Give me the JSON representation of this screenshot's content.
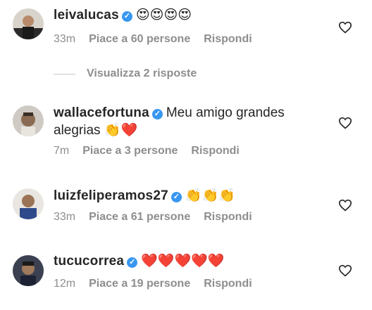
{
  "comments": [
    {
      "username": "leivalucas",
      "text": "",
      "emojis": "😍😍😍😍",
      "time": "33m",
      "likes": "Piace a 60 persone",
      "reply": "Rispondi"
    },
    {
      "username": "wallacefortuna",
      "text": "Meu amigo grandes",
      "text2": "alegrias",
      "emojis": "👏❤️",
      "time": "7m",
      "likes": "Piace a 3 persone",
      "reply": "Rispondi"
    },
    {
      "username": "luizfeliperamos27",
      "text": "",
      "emojis": "👏👏👏",
      "time": "33m",
      "likes": "Piace a 61 persone",
      "reply": "Rispondi"
    },
    {
      "username": "tucucorrea",
      "text": "",
      "emojis": "❤️❤️❤️❤️❤️",
      "time": "12m",
      "likes": "Piace a 19 persone",
      "reply": "Rispondi"
    }
  ],
  "thread": {
    "label": "Visualizza 2 risposte"
  },
  "icons": {
    "verified": "verified-badge-icon",
    "like": "heart-outline-icon"
  },
  "colors": {
    "verified": "#3897f0",
    "meta": "#8e8e8e",
    "text": "#262626"
  }
}
